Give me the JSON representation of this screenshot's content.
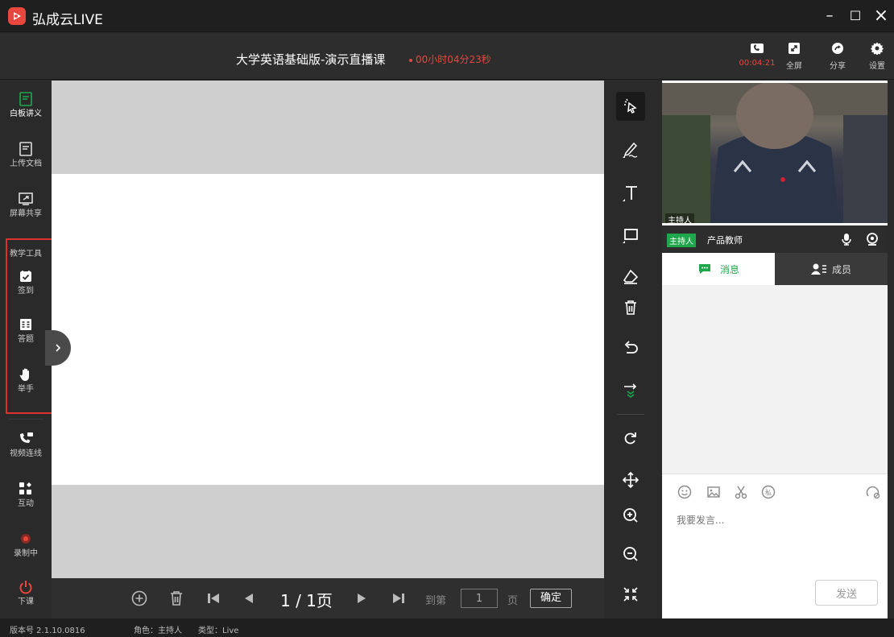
{
  "app": {
    "name": "弘成云LIVE"
  },
  "window": {
    "minimize": "–",
    "maximize": "☐",
    "close": "×"
  },
  "header": {
    "course_title": "大学英语基础版-演示直播课",
    "elapsed": "00小时04分23秒",
    "buttons": [
      {
        "label": "00:04:21",
        "icon": "video-call-icon"
      },
      {
        "label": "全屏",
        "icon": "fullscreen-icon"
      },
      {
        "label": "分享",
        "icon": "share-icon"
      },
      {
        "label": "设置",
        "icon": "gear-icon"
      }
    ]
  },
  "sidebar": {
    "items": [
      {
        "label": "白板讲义",
        "icon": "whiteboard-icon"
      },
      {
        "label": "上传文档",
        "icon": "document-icon"
      },
      {
        "label": "屏幕共享",
        "icon": "screen-share-icon"
      }
    ],
    "tools_heading": "教学工具",
    "tools": [
      {
        "label": "签到",
        "icon": "checkin-icon"
      },
      {
        "label": "答题",
        "icon": "quiz-icon"
      },
      {
        "label": "举手",
        "icon": "raise-hand-icon"
      }
    ],
    "bottom": [
      {
        "label": "视频连线",
        "icon": "video-link-icon"
      },
      {
        "label": "互动",
        "icon": "interaction-icon"
      },
      {
        "label": "录制中",
        "icon": "recording-icon"
      },
      {
        "label": "下课",
        "icon": "power-icon"
      }
    ]
  },
  "pager": {
    "page_text": "1 / 1页",
    "goto_label": "到第",
    "page_input": "1",
    "page_suffix": "页",
    "confirm": "确定"
  },
  "video": {
    "overlay_label": "主持人"
  },
  "host": {
    "tag": "主持人",
    "name": "产品教师"
  },
  "tabs": {
    "messages": "消息",
    "members": "成员"
  },
  "chat": {
    "placeholder": "我要发言...",
    "send": "发送"
  },
  "status": {
    "version": "版本号 2.1.10.0816",
    "role": "角色：主持人",
    "type": "类型：Live"
  },
  "colors": {
    "accent_green": "#1fa74c",
    "accent_red": "#e8473d",
    "highlight_border": "#e0302c"
  }
}
